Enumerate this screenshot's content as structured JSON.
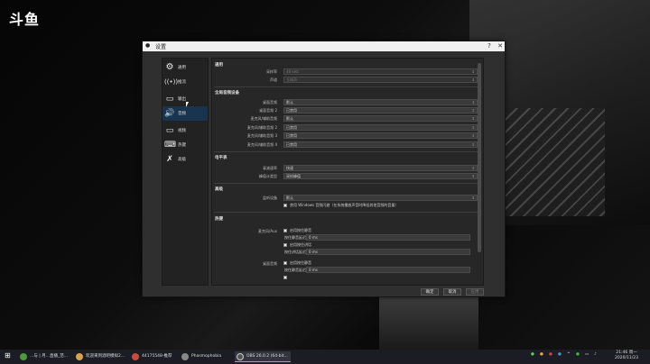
{
  "stream_logo": "斗鱼",
  "background": {
    "main_window_labels": [
      "场景选",
      "来源日",
      "混音"
    ]
  },
  "dialog": {
    "title": "设置",
    "controls": {
      "help": "?",
      "close": "✕"
    }
  },
  "sidebar": {
    "items": [
      {
        "label": "通用",
        "icon": "gear-icon"
      },
      {
        "label": "推流",
        "icon": "stream-icon"
      },
      {
        "label": "输出",
        "icon": "output-icon"
      },
      {
        "label": "音频",
        "icon": "speaker-icon"
      },
      {
        "label": "视频",
        "icon": "monitor-icon"
      },
      {
        "label": "热键",
        "icon": "keyboard-icon"
      },
      {
        "label": "高级",
        "icon": "tools-icon"
      }
    ],
    "active_index": 3
  },
  "content": {
    "general": {
      "title": "通用",
      "rows": [
        {
          "label": "采样率",
          "value": "48 kHz"
        },
        {
          "label": "声道",
          "value": "立体声"
        }
      ]
    },
    "global_devices": {
      "title": "全局音频设备",
      "rows": [
        {
          "label": "桌面音频",
          "value": "默认"
        },
        {
          "label": "桌面音频 2",
          "value": "已禁用"
        },
        {
          "label": "麦克风/辅助音频",
          "value": "默认"
        },
        {
          "label": "麦克风/辅助音频 2",
          "value": "已禁用"
        },
        {
          "label": "麦克风/辅助音频 3",
          "value": "已禁用"
        },
        {
          "label": "麦克风/辅助音频 4",
          "value": "已禁用"
        }
      ]
    },
    "meters": {
      "title": "电平表",
      "rows": [
        {
          "label": "衰减速率",
          "value": "快速"
        },
        {
          "label": "峰值计类型",
          "value": "采样峰值"
        }
      ]
    },
    "advanced": {
      "title": "高级",
      "monitor_label": "监听设备",
      "monitor_value": "默认",
      "ducking_text": "禁用 Windows 音频闪避（在系统播放声音时降低其他音频的音量）"
    },
    "hotkeys": {
      "title": "热键",
      "mic_label": "麦克风/Aux",
      "desktop_label": "桌面音频",
      "push_to_mute": "启用按住静音",
      "push_to_mute_delay": "按住静音延迟",
      "push_to_talk": "启用按住讲话",
      "push_to_talk_delay": "按住讲话延迟",
      "delay_value": "0 ms"
    }
  },
  "buttons": {
    "ok": "确定",
    "cancel": "取消",
    "apply": "应用"
  },
  "taskbar": {
    "items": [
      {
        "label": "...与 | 月...直播_范..."
      },
      {
        "label": "欢迎来到酒吧模拟2..."
      },
      {
        "label": "44175548-推荐"
      },
      {
        "label": "Phasmophobia"
      },
      {
        "label": "OBS 26.0.2 (64-bit..."
      }
    ],
    "clock_time": "21:46 周一",
    "clock_date": "2020/11/23"
  }
}
